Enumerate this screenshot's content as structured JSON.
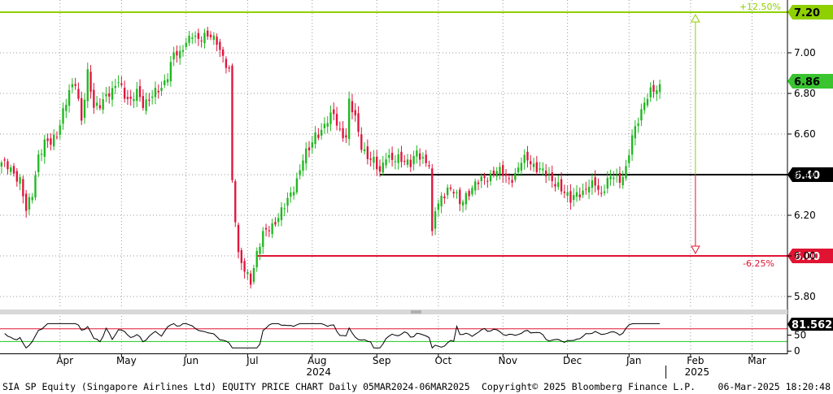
{
  "chart_data": {
    "type": "candlestick",
    "ticker": "SIA SP Equity",
    "company": "(Singapore Airlines Ltd)",
    "chart_label": "EQUITY PRICE CHART",
    "period": "Daily 05MAR2024-06MAR2025",
    "copyright": "Copyright© 2025 Bloomberg Finance L.P.",
    "timestamp": "06-Mar-2025  18:20:48",
    "ylim": [
      5.74,
      7.26
    ],
    "y_ticks": [
      "5.80",
      "6.00",
      "6.20",
      "6.40",
      "6.60",
      "6.80",
      "7.00"
    ],
    "x_months": [
      {
        "label": "Apr",
        "index": 19
      },
      {
        "label": "May",
        "index": 39
      },
      {
        "label": "Jun",
        "index": 60
      },
      {
        "label": "Jul",
        "index": 80
      },
      {
        "label": "Aug",
        "index": 101
      },
      {
        "label": "Sep",
        "index": 122
      },
      {
        "label": "Oct",
        "index": 142
      },
      {
        "label": "Nov",
        "index": 163
      },
      {
        "label": "Dec",
        "index": 184
      },
      {
        "label": "Jan",
        "index": 204
      },
      {
        "label": "Feb",
        "index": 224
      },
      {
        "label": "Mar",
        "index": 244
      }
    ],
    "x_years": [
      {
        "label": "2024",
        "index": 101
      },
      {
        "label": "2025",
        "index": 224
      }
    ],
    "year_divider_index": 216,
    "total_slots": 256,
    "close_anchors": [
      [
        0,
        6.46
      ],
      [
        3,
        6.42
      ],
      [
        6,
        6.38
      ],
      [
        8,
        6.22
      ],
      [
        10,
        6.3
      ],
      [
        12,
        6.5
      ],
      [
        14,
        6.56
      ],
      [
        16,
        6.55
      ],
      [
        18,
        6.6
      ],
      [
        20,
        6.72
      ],
      [
        22,
        6.8
      ],
      [
        24,
        6.85
      ],
      [
        26,
        6.68
      ],
      [
        28,
        6.9
      ],
      [
        30,
        6.72
      ],
      [
        32,
        6.75
      ],
      [
        34,
        6.8
      ],
      [
        36,
        6.8
      ],
      [
        38,
        6.86
      ],
      [
        40,
        6.8
      ],
      [
        42,
        6.76
      ],
      [
        44,
        6.8
      ],
      [
        46,
        6.75
      ],
      [
        48,
        6.78
      ],
      [
        50,
        6.8
      ],
      [
        52,
        6.82
      ],
      [
        54,
        6.9
      ],
      [
        56,
        7.0
      ],
      [
        58,
        6.98
      ],
      [
        60,
        7.06
      ],
      [
        62,
        7.1
      ],
      [
        64,
        7.05
      ],
      [
        66,
        7.08
      ],
      [
        68,
        7.1
      ],
      [
        70,
        7.05
      ],
      [
        72,
        6.96
      ],
      [
        74,
        6.92
      ],
      [
        75,
        6.38
      ],
      [
        77,
        6.0
      ],
      [
        79,
        5.92
      ],
      [
        81,
        5.88
      ],
      [
        83,
        6.02
      ],
      [
        85,
        6.1
      ],
      [
        88,
        6.15
      ],
      [
        90,
        6.2
      ],
      [
        92,
        6.24
      ],
      [
        94,
        6.3
      ],
      [
        96,
        6.38
      ],
      [
        98,
        6.48
      ],
      [
        100,
        6.52
      ],
      [
        102,
        6.6
      ],
      [
        104,
        6.62
      ],
      [
        106,
        6.66
      ],
      [
        108,
        6.7
      ],
      [
        110,
        6.62
      ],
      [
        112,
        6.58
      ],
      [
        113,
        6.75
      ],
      [
        115,
        6.68
      ],
      [
        117,
        6.55
      ],
      [
        119,
        6.48
      ],
      [
        121,
        6.46
      ],
      [
        123,
        6.42
      ],
      [
        125,
        6.5
      ],
      [
        127,
        6.46
      ],
      [
        129,
        6.48
      ],
      [
        131,
        6.48
      ],
      [
        133,
        6.45
      ],
      [
        135,
        6.5
      ],
      [
        137,
        6.48
      ],
      [
        139,
        6.46
      ],
      [
        140,
        6.1
      ],
      [
        141,
        6.22
      ],
      [
        143,
        6.28
      ],
      [
        145,
        6.34
      ],
      [
        147,
        6.32
      ],
      [
        149,
        6.25
      ],
      [
        151,
        6.3
      ],
      [
        153,
        6.34
      ],
      [
        155,
        6.36
      ],
      [
        157,
        6.38
      ],
      [
        159,
        6.4
      ],
      [
        161,
        6.42
      ],
      [
        163,
        6.4
      ],
      [
        165,
        6.38
      ],
      [
        167,
        6.4
      ],
      [
        169,
        6.46
      ],
      [
        171,
        6.48
      ],
      [
        173,
        6.45
      ],
      [
        175,
        6.42
      ],
      [
        177,
        6.4
      ],
      [
        179,
        6.38
      ],
      [
        181,
        6.35
      ],
      [
        183,
        6.3
      ],
      [
        185,
        6.28
      ],
      [
        187,
        6.32
      ],
      [
        189,
        6.3
      ],
      [
        191,
        6.34
      ],
      [
        193,
        6.37
      ],
      [
        195,
        6.3
      ],
      [
        197,
        6.36
      ],
      [
        199,
        6.4
      ],
      [
        201,
        6.38
      ],
      [
        203,
        6.42
      ],
      [
        205,
        6.58
      ],
      [
        207,
        6.68
      ],
      [
        209,
        6.76
      ],
      [
        211,
        6.8
      ],
      [
        213,
        6.82
      ],
      [
        214,
        6.84
      ]
    ],
    "current_price": {
      "value": 6.86,
      "label": "6.86",
      "color": "#39c430"
    },
    "levels": [
      {
        "name": "target",
        "value": 7.2,
        "label": "7.20",
        "pct": "+12.50%",
        "color": "#8fd000"
      },
      {
        "name": "support",
        "value": 6.4,
        "label": "6.40",
        "color": "#000000"
      },
      {
        "name": "stop",
        "value": 6.0,
        "label": "6.00",
        "pct": "-6.25%",
        "color": "#e01432"
      }
    ],
    "support_from_index": 123,
    "stop_from_index": 83,
    "arrow_index": 224,
    "indicator": {
      "label": "81.5628",
      "value": 81.56,
      "ylim": [
        -2,
        110
      ],
      "ticks": [
        "50",
        "0"
      ],
      "upper_band": 70,
      "lower_band": 30,
      "upper_color": "#e01432",
      "lower_color": "#1fcc1f",
      "line_color": "#000000"
    },
    "colors": {
      "up": "#1fb81f",
      "down": "#e0143c",
      "grid": "#9a9a9a"
    }
  }
}
